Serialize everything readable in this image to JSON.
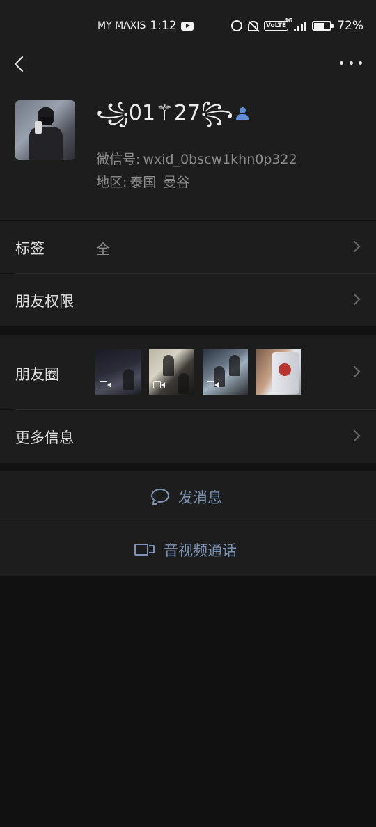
{
  "status_bar": {
    "carrier": "MY MAXIS",
    "time": "1:12",
    "network": "4G",
    "volte": "VoLTE",
    "battery": "72%",
    "icons": [
      "youtube-icon",
      "alarm-icon",
      "bell-off-icon",
      "volte-icon",
      "signal-icon",
      "battery-icon"
    ]
  },
  "nav": {
    "back_icon": "back-chevron-icon",
    "more_icon": "more-dots-icon"
  },
  "profile": {
    "nickname": "꧁01⚚27꧂",
    "wxid_label": "微信号:",
    "wxid": "wxid_0bscw1khn0p322",
    "region_label": "地区:",
    "region_country": "泰国",
    "region_city": "曼谷"
  },
  "rows": {
    "tags_title": "标签",
    "tags_value": "全",
    "permissions_title": "朋友权限",
    "moments_title": "朋友圈",
    "more_info_title": "更多信息"
  },
  "actions": {
    "send_message": "发消息",
    "av_call": "音视频通话"
  },
  "colors": {
    "background": "#111111",
    "panel": "#1d1d1d",
    "link_blue": "#7d93b4",
    "contact_icon": "#5e8fd6"
  }
}
